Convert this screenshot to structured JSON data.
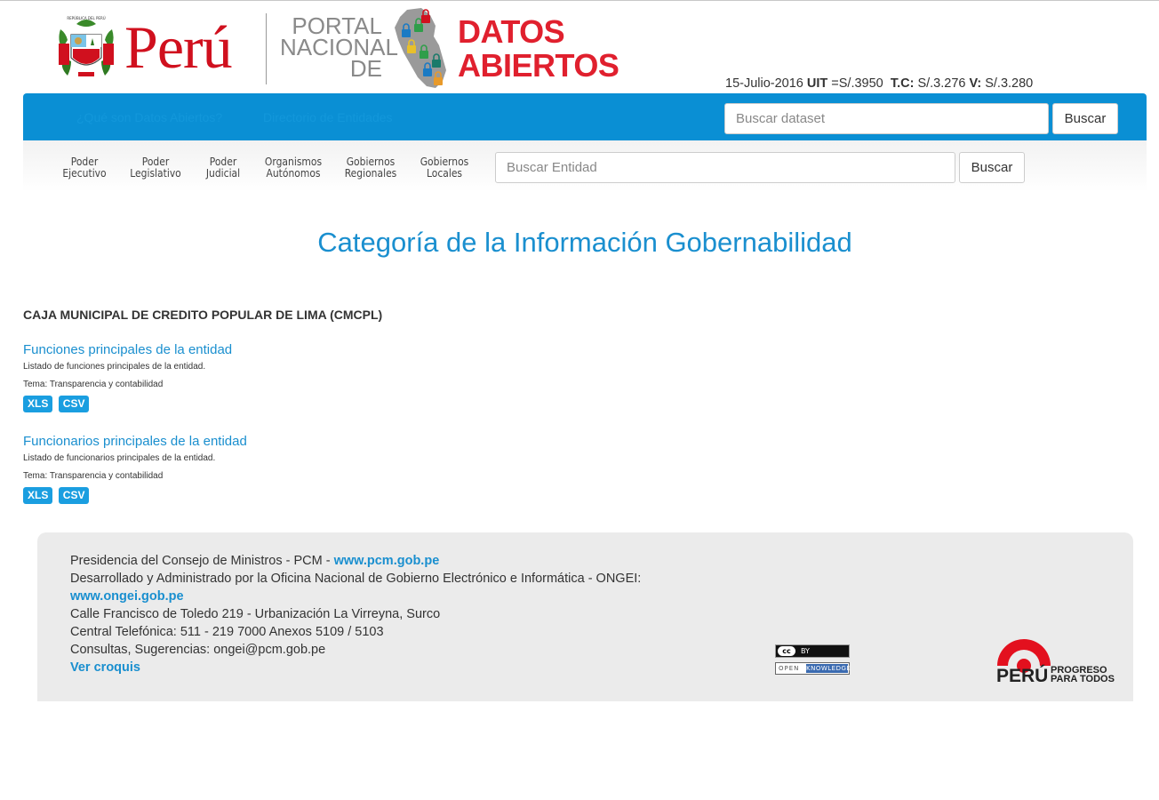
{
  "header": {
    "escudo_text": "REPÚBLICA DEL PERÚ",
    "peru_word": "Perú",
    "portal_lines": [
      "PORTAL",
      "NACIONAL",
      "DE"
    ],
    "datos_lines": [
      "DATOS",
      "ABIERTOS"
    ],
    "date": "15-Julio-2016",
    "uit_label": "UIT",
    "uit_value": "=S/.3950",
    "tc_label": "T.C:",
    "tc_value": "S/.3.276",
    "v_label": "V:",
    "v_value": "S/.3.280"
  },
  "topnav": {
    "links": [
      "¿Qué son Datos Abiertos?",
      "Directorio de Entidades"
    ],
    "search_placeholder": "Buscar dataset",
    "search_button": "Buscar"
  },
  "categories": {
    "items": [
      {
        "line1": "Poder",
        "line2": "Ejecutivo"
      },
      {
        "line1": "Poder",
        "line2": "Legislativo"
      },
      {
        "line1": "Poder",
        "line2": "Judicial"
      },
      {
        "line1": "Organismos",
        "line2": "Autónomos"
      },
      {
        "line1": "Gobiernos",
        "line2": "Regionales"
      },
      {
        "line1": "Gobiernos",
        "line2": "Locales"
      }
    ],
    "search_placeholder": "Buscar Entidad",
    "search_button": "Buscar"
  },
  "main": {
    "title": "Categoría de la Información Gobernabilidad",
    "entity": "CAJA MUNICIPAL DE CREDITO POPULAR DE LIMA (CMCPL)",
    "datasets": [
      {
        "title": "Funciones principales de la entidad",
        "description": "Listado de funciones principales de la entidad.",
        "tema": "Tema: Transparencia y contabilidad",
        "formats": [
          "XLS",
          "CSV"
        ]
      },
      {
        "title": "Funcionarios principales de la entidad",
        "description": "Listado de funcionarios principales de la entidad.",
        "tema": "Tema: Transparencia y contabilidad",
        "formats": [
          "XLS",
          "CSV"
        ]
      }
    ]
  },
  "footer": {
    "line1_text": "Presidencia del Consejo de Ministros - PCM - ",
    "line1_link": "www.pcm.gob.pe",
    "line2_text": "Desarrollado y Administrado por la Oficina Nacional de Gobierno Electrónico e Informática - ONGEI:",
    "line3_link": "www.ongei.gob.pe",
    "line4_text": "Calle Francisco de Toledo 219 - Urbanización La Virreyna, Surco",
    "line5_text": "Central Telefónica: 511 - 219 7000 Anexos 5109 / 5103",
    "line6_text": "Consultas, Sugerencias: ongei@pcm.gob.pe",
    "line7_link": "Ver croquis",
    "cc_label": "cc",
    "by_label": "BY",
    "open_label": "OPEN",
    "knowledge_label": "KNOWLEDGE",
    "peru_logo_word": "PERÚ",
    "peru_logo_tagline1": "PROGRESO",
    "peru_logo_tagline2": "PARA TODOS"
  },
  "colors": {
    "primary_blue": "#0a8fd4",
    "link_blue": "#1a8fcf",
    "badge_blue": "#1a9ee0",
    "brand_red": "#d0101e",
    "footer_bg": "#ebebeb"
  }
}
